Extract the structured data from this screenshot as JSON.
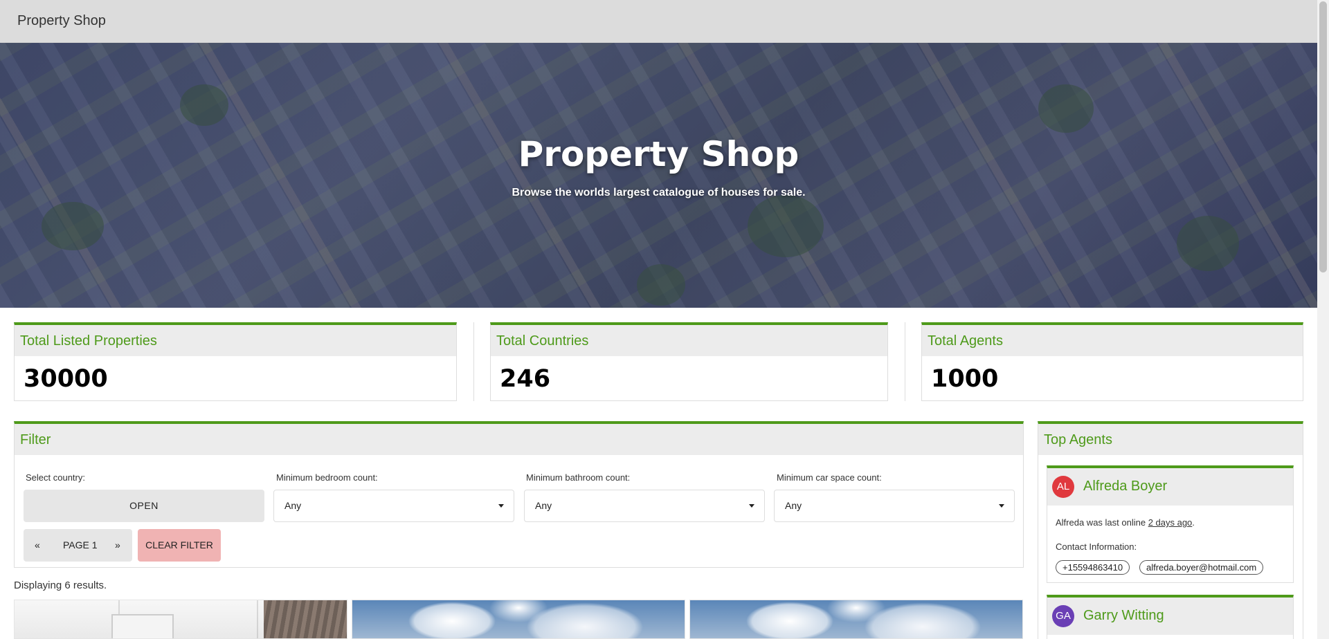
{
  "navbar": {
    "brand": "Property Shop"
  },
  "hero": {
    "title": "Property Shop",
    "subtitle": "Browse the worlds largest catalogue of houses for sale."
  },
  "stats": [
    {
      "label": "Total Listed Properties",
      "value": "30000"
    },
    {
      "label": "Total Countries",
      "value": "246"
    },
    {
      "label": "Total Agents",
      "value": "1000"
    }
  ],
  "filter": {
    "title": "Filter",
    "country_label": "Select country:",
    "open_button": "OPEN",
    "bedroom_label": "Minimum bedroom count:",
    "bedroom_value": "Any",
    "bathroom_label": "Minimum bathroom count:",
    "bathroom_value": "Any",
    "car_label": "Minimum car space count:",
    "car_value": "Any",
    "prev_page": "«",
    "page_label": "PAGE 1",
    "next_page": "»",
    "clear_button": "CLEAR FILTER"
  },
  "results": {
    "text": "Displaying 6 results."
  },
  "top_agents": {
    "title": "Top Agents",
    "agents": [
      {
        "initials": "AL",
        "name": "Alfreda Boyer",
        "color": "#e0393e",
        "last_online_prefix": "Alfreda was last online ",
        "last_online": "2 days ago",
        "last_online_suffix": ".",
        "contact_label": "Contact Information:",
        "phone": "+15594863410",
        "email": "alfreda.boyer@hotmail.com"
      },
      {
        "initials": "GA",
        "name": "Garry Witting",
        "color": "#6a3fb5"
      }
    ]
  },
  "colors": {
    "accent": "#4e9a1a",
    "clear_button": "#f0b3b3",
    "navbar": "#dcdcdc"
  }
}
